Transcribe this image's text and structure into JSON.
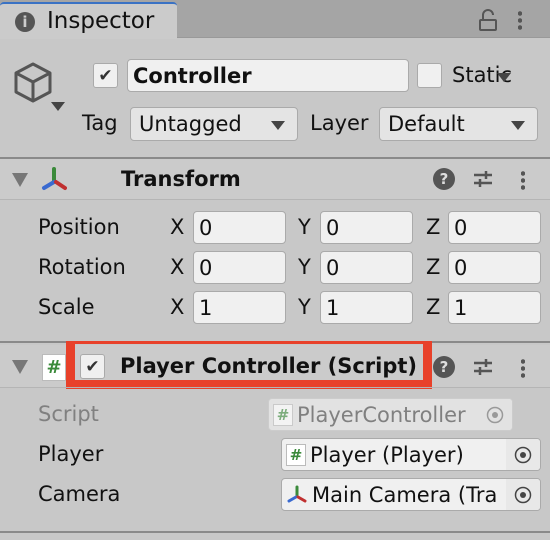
{
  "window": {
    "tab_title": "Inspector",
    "icons": [
      "info-icon",
      "lock-icon",
      "kebab-menu-icon"
    ]
  },
  "gameobject": {
    "active": true,
    "name": "Controller",
    "static": false,
    "static_label": "Static",
    "tag_label": "Tag",
    "tag_value": "Untagged",
    "layer_label": "Layer",
    "layer_value": "Default"
  },
  "transform": {
    "title": "Transform",
    "rows": [
      {
        "label": "Position",
        "x": "0",
        "y": "0",
        "z": "0"
      },
      {
        "label": "Rotation",
        "x": "0",
        "y": "0",
        "z": "0"
      },
      {
        "label": "Scale",
        "x": "1",
        "y": "1",
        "z": "1"
      }
    ],
    "axis_labels": {
      "x": "X",
      "y": "Y",
      "z": "Z"
    }
  },
  "script_component": {
    "title": "Player Controller (Script)",
    "enabled": true,
    "highlight_color": "#e8412a",
    "hash": "#",
    "fields": [
      {
        "label": "Script",
        "value": "PlayerController",
        "disabled": true
      },
      {
        "label": "Player",
        "value": "Player (Player)"
      },
      {
        "label": "Camera",
        "value": "Main Camera (Tra"
      }
    ]
  }
}
